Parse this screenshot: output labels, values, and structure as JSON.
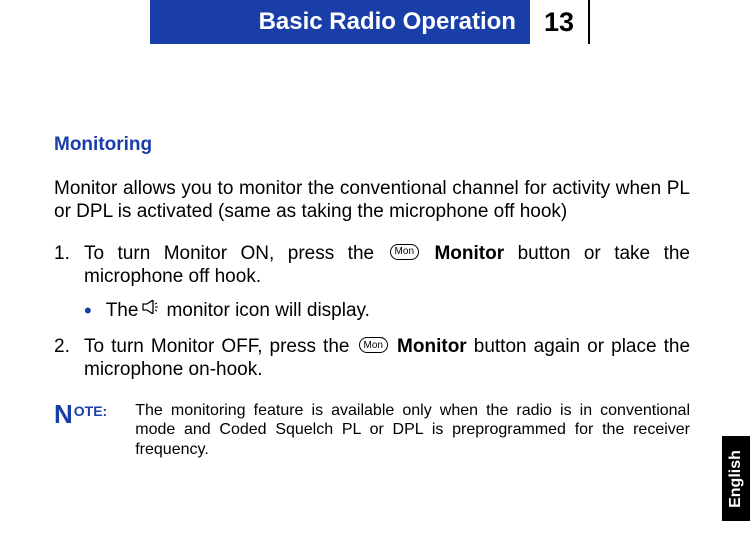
{
  "header": {
    "title": "Basic Radio Operation",
    "page": "13"
  },
  "section": {
    "heading": "Monitoring",
    "intro": "Monitor allows you to monitor the conventional channel for activity when PL or DPL is activated (same as taking the microphone off hook)",
    "step1_num": "1.",
    "step1_a": "To turn Monitor ON, press the ",
    "step1_btn": "Mon",
    "step1_b": " ",
    "step1_bold": "Monitor",
    "step1_c": " button or take the microphone off hook.",
    "bullet_a": "The ",
    "bullet_b": " monitor icon will display.",
    "step2_num": "2.",
    "step2_a": "To turn Monitor OFF, press the ",
    "step2_btn": "Mon",
    "step2_b": " ",
    "step2_bold": "Monitor",
    "step2_c": " button again or place the microphone on-hook."
  },
  "note": {
    "n": "N",
    "label": "OTE:",
    "text": "The monitoring feature is available only when the radio is in conventional mode and Coded Squelch PL or DPL is preprogrammed for the receiver frequency."
  },
  "sidetab": "English"
}
